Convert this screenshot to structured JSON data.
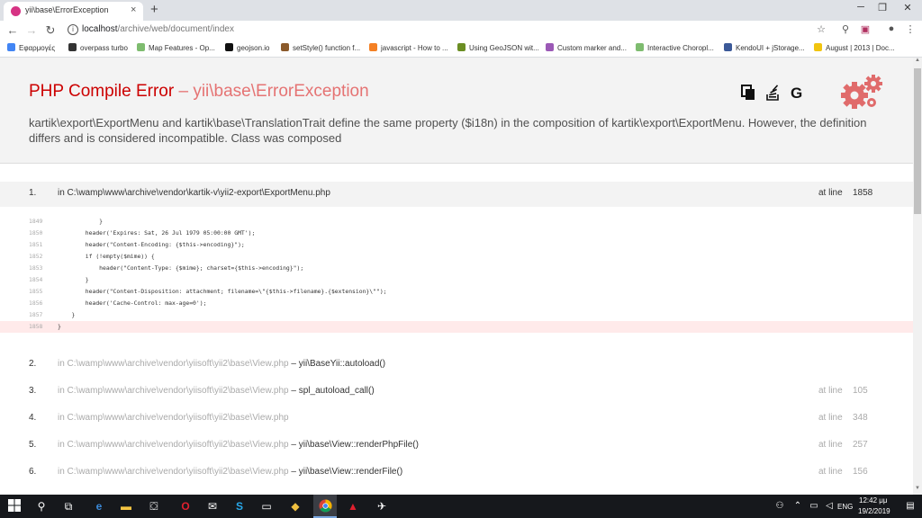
{
  "browser": {
    "tab_title": "yii\\base\\ErrorException",
    "tab_close": "×",
    "new_tab": "+",
    "window_minimize": "─",
    "window_restore": "❐",
    "window_close": "✕",
    "url_host": "localhost",
    "url_path": "/archive/web/document/index",
    "bookmarks": [
      {
        "label": "Εφαρμογές",
        "color": "#4285f4"
      },
      {
        "label": "overpass turbo",
        "color": "#333333"
      },
      {
        "label": "Map Features - Op...",
        "color": "#7ebc6f"
      },
      {
        "label": "geojson.io",
        "color": "#111111"
      },
      {
        "label": "setStyle() function f...",
        "color": "#8b5a2b"
      },
      {
        "label": "javascript - How to ...",
        "color": "#f48024"
      },
      {
        "label": "Using GeoJSON wit...",
        "color": "#6b8e23"
      },
      {
        "label": "Custom marker and...",
        "color": "#9b59b6"
      },
      {
        "label": "Interactive Choropl...",
        "color": "#7ebc6f"
      },
      {
        "label": "KendoUI + jStorage...",
        "color": "#3b5998"
      },
      {
        "label": "August | 2013 | Doc...",
        "color": "#f1c40f"
      }
    ]
  },
  "error": {
    "title": "PHP Compile Error",
    "separator": " – ",
    "class": "yii\\base\\ErrorException",
    "message": "kartik\\export\\ExportMenu and kartik\\base\\TranslationTrait define the same property ($i18n) in the composition of kartik\\export\\ExportMenu. However, the definition differs and is considered incompatible. Class was composed",
    "icons": [
      "copy-icon",
      "stackoverflow-icon",
      "google-icon"
    ]
  },
  "frames": [
    {
      "num": "1.",
      "path": "in C:\\wamp\\www\\archive\\vendor\\kartik-v\\yii2-export\\ExportMenu.php",
      "call": "",
      "at_line": "at line",
      "line": "1858",
      "active": true
    },
    {
      "num": "2.",
      "path": "in C:\\wamp\\www\\archive\\vendor\\yiisoft\\yii2\\base\\View.php",
      "call": " – yii\\BaseYii::autoload()",
      "at_line": "",
      "line": "",
      "active": false
    },
    {
      "num": "3.",
      "path": "in C:\\wamp\\www\\archive\\vendor\\yiisoft\\yii2\\base\\View.php",
      "call": " – spl_autoload_call()",
      "at_line": "at line",
      "line": "105",
      "active": false
    },
    {
      "num": "4.",
      "path": "in C:\\wamp\\www\\archive\\vendor\\yiisoft\\yii2\\base\\View.php",
      "call": "",
      "at_line": "at line",
      "line": "348",
      "active": false
    },
    {
      "num": "5.",
      "path": "in C:\\wamp\\www\\archive\\vendor\\yiisoft\\yii2\\base\\View.php",
      "call": " – yii\\base\\View::renderPhpFile()",
      "at_line": "at line",
      "line": "257",
      "active": false
    },
    {
      "num": "6.",
      "path": "in C:\\wamp\\www\\archive\\vendor\\yiisoft\\yii2\\base\\View.php",
      "call": " – yii\\base\\View::renderFile()",
      "at_line": "at line",
      "line": "156",
      "active": false
    }
  ],
  "code_lines": [
    {
      "n": "1849",
      "code": "            }",
      "hl": false
    },
    {
      "n": "1850",
      "code": "        header('Expires: Sat, 26 Jul 1979 05:00:00 GMT');",
      "hl": false
    },
    {
      "n": "1851",
      "code": "        header(\"Content-Encoding: {$this->encoding}\");",
      "hl": false
    },
    {
      "n": "1852",
      "code": "        if (!empty($mime)) {",
      "hl": false
    },
    {
      "n": "1853",
      "code": "            header(\"Content-Type: {$mime}; charset={$this->encoding}\");",
      "hl": false
    },
    {
      "n": "1854",
      "code": "        }",
      "hl": false
    },
    {
      "n": "1855",
      "code": "        header(\"Content-Disposition: attachment; filename=\\\"{$this->filename}.{$extension}\\\"\");",
      "hl": false
    },
    {
      "n": "1856",
      "code": "        header('Cache-Control: max-age=0');",
      "hl": false
    },
    {
      "n": "1857",
      "code": "    }",
      "hl": false
    },
    {
      "n": "1858",
      "code": "}",
      "hl": true
    }
  ],
  "taskbar": {
    "lang": "ENG",
    "time": "12:42 μμ",
    "date": "19/2/2019"
  }
}
